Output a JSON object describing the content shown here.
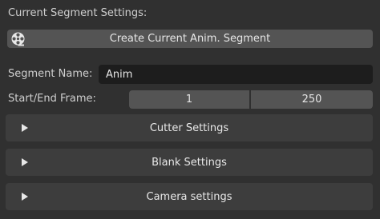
{
  "section_title": "Current Segment Settings:",
  "create_button": {
    "label": "Create Current Anim. Segment",
    "icon": "film-reel-icon"
  },
  "segment_name": {
    "label": "Segment Name:",
    "value": "Anim"
  },
  "frames": {
    "label": "Start/End Frame:",
    "start": "1",
    "end": "250"
  },
  "panels": [
    {
      "label": "Cutter Settings",
      "expanded": false
    },
    {
      "label": "Blank Settings",
      "expanded": false
    },
    {
      "label": "Camera settings",
      "expanded": false
    }
  ],
  "colors": {
    "background": "#303030",
    "button": "#545454",
    "field": "#1d1d1d",
    "panel": "#3d3d3d"
  }
}
